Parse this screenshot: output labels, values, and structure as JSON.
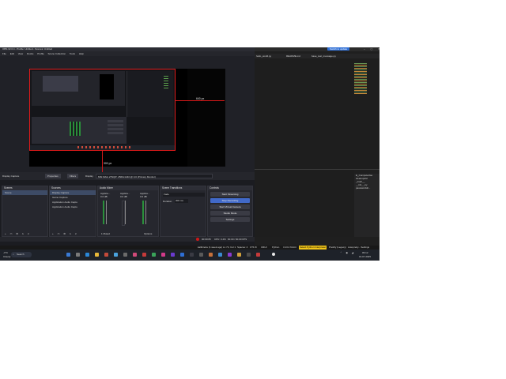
{
  "window": {
    "title": "OBS 32.0.4 - Profile: Untitled - Scenes: Untitled",
    "menu": [
      "File",
      "Edit",
      "View",
      "Docks",
      "Profile",
      "Scene Collection",
      "Tools",
      "Help"
    ]
  },
  "preview": {
    "width_label": "640 px",
    "height_label": "300 px"
  },
  "context_bar": {
    "source_name": "Display Capture",
    "properties": "Properties",
    "filters": "Filters",
    "display_label": "Display",
    "display_value": "MSI MAG 27SQP: 2560x1440 @ 0,0 (Primary Monitor)"
  },
  "scenes": {
    "title": "Scenes",
    "items": [
      "Scene"
    ]
  },
  "sources": {
    "title": "Sources",
    "items": [
      "Display Capture",
      "Game Capture",
      "Application Audio Captu",
      "Application Audio Captu"
    ]
  },
  "mixer": {
    "title": "Audio Mixer",
    "channels": [
      {
        "name": "Applica...",
        "level": "0.0 dB"
      },
      {
        "name": "Applica...",
        "level": "0.0 dB"
      },
      {
        "name": "Applica...",
        "level": "0.0 dB"
      }
    ],
    "muted_text": "1 Muted",
    "options": "Options"
  },
  "transitions": {
    "title": "Scene Transitions",
    "type": "Fade",
    "duration_label": "Duration",
    "duration_value": "300 ms"
  },
  "controls": {
    "title": "Controls",
    "buttons": [
      {
        "label": "Start Streaming",
        "active": false
      },
      {
        "label": "Stop Recording",
        "active": true
      },
      {
        "label": "Start Virtual Camera",
        "active": false
      },
      {
        "label": "Studio Mode",
        "active": false
      },
      {
        "label": "Settings",
        "active": false
      }
    ]
  },
  "status": {
    "rec_time": "00:00:05",
    "cpu": "CPU: 0.4%",
    "fps": "60.00 / 60.00 FPS"
  },
  "editor": {
    "tabs": [
      "hello_world.py",
      "README.md",
      "base_test_message.py"
    ],
    "toast": "Switch to update",
    "panel_items": [
      "E_ComputeUse",
      "cleanupold",
      "_main__",
      "__init__.py",
      "passwordoll..."
    ]
  },
  "taskbar": {
    "weather_temp": "-3°C",
    "weather_text": "Cloudy",
    "search_placeholder": "Search",
    "status_items": [
      "kalibrierte (1 week ago)",
      "Ln 74, Col 1",
      "Spaces: 4",
      "UTF-8",
      "CRLF",
      "Python",
      "3.13.2 64-bit",
      "Select Python Interpreter",
      "Prettify (Legacy)",
      "Autopretty - Settings"
    ],
    "clock": "09:12",
    "date": "16.07.2025"
  },
  "colors": {
    "accent": "#4169c8",
    "record_red": "#d01818",
    "meter_green": "#2a8f3a",
    "interpreter_yellow": "#f0c419"
  }
}
